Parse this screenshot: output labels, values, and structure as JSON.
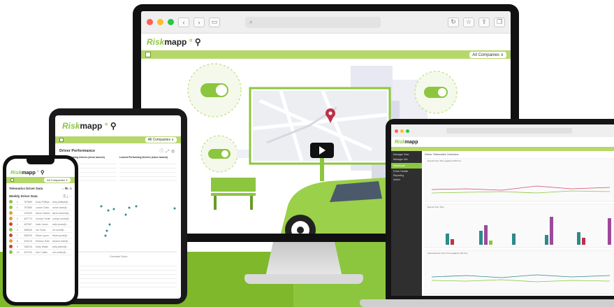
{
  "brand": {
    "name_prefix": "Risk",
    "name_suffix": "mapp"
  },
  "colors": {
    "accent": "#8cc63f",
    "accent_bar": "#b6d76a",
    "pink": "#d4447e",
    "teal": "#2d8a8a",
    "red_pin": "#c0304a"
  },
  "monitor": {
    "controls": [
      "‹",
      "›"
    ],
    "right_icons": [
      "reload-icon",
      "star-icon",
      "share-icon",
      "tabs-icon"
    ],
    "company_pill": "All Companies ∨",
    "scene": {
      "play_icon": "play-icon",
      "pin_icon": "map-pin-icon"
    }
  },
  "tablet": {
    "company_pill": "All Companies ∨",
    "panel_title": "Driver Performance",
    "left_table_title": "Best Performing Drivers (since launch)",
    "right_table_title": "Lowest Performing Drivers (since launch)",
    "scatter_axis": "Corrected Score"
  },
  "phone": {
    "company_pill": "All Companies ∨",
    "page_title": "Telematics Driver Data",
    "sub_title": "Weekly Driver Data",
    "rows": [
      {
        "n": "1",
        "id": "787885",
        "name": "Andy Phillips",
        "email": "andy.phillips@..."
      },
      {
        "n": "1",
        "id": "787880",
        "name": "Louise Clark",
        "email": "louise.clark@..."
      },
      {
        "n": "",
        "id": "120209",
        "name": "Aaron Hawes",
        "email": "aaron.hawes@..."
      },
      {
        "n": "2",
        "id": "487770",
        "name": "Jocelyn Smith",
        "email": "jocelyn.smith@..."
      },
      {
        "n": "4",
        "id": "487567",
        "name": "Katie Jones",
        "email": "katie.jones@..."
      },
      {
        "n": "4",
        "id": "485630",
        "name": "Joe Scott",
        "email": "joe.scott@..."
      },
      {
        "n": "7",
        "id": "365009",
        "name": "Ethan Lyons",
        "email": "ethan.lyons@..."
      },
      {
        "n": "8",
        "id": "420019",
        "name": "Eleanor Hale",
        "email": "eleanor.hale@..."
      },
      {
        "n": "9",
        "id": "158215",
        "name": "Andy Walsh",
        "email": "andy.walsh@..."
      },
      {
        "n": "10",
        "id": "267919",
        "name": "Tom Cullen",
        "email": "tom.cullen@..."
      }
    ]
  },
  "laptop": {
    "sidebar": [
      "Manager View",
      "Manager Info",
      "Dashboard",
      "Driver Details",
      "Reporting",
      "Admin"
    ],
    "panel_title": "Driver Telematics Overview",
    "chart1_title": "Events Over Time (Against 100 Km)",
    "chart2_title": "Events Over Time",
    "chart3_title": "Speed Events Over Time (Against 100 Km)"
  }
}
